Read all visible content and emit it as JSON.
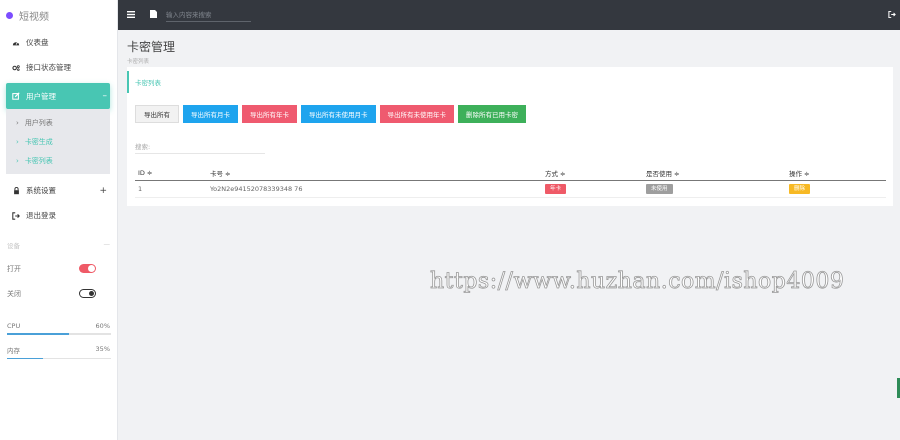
{
  "brand": {
    "name": "短视频",
    "color": "#7c4dff"
  },
  "topbar": {
    "menu_icon": "list-icon",
    "page_icon": "document-icon",
    "search_placeholder": "输入内容来搜索",
    "right_icon": "logout-icon"
  },
  "sidebar": {
    "items": [
      {
        "label": "仪表盘",
        "icon": "dashboard-icon"
      },
      {
        "label": "接口状态管理",
        "icon": "cogs-icon"
      },
      {
        "label": "用户管理",
        "icon": "edit-icon",
        "sign": "–"
      },
      {
        "label": "系统设置",
        "icon": "lock-icon",
        "sign": "+"
      },
      {
        "label": "退出登录",
        "icon": "logout-icon"
      }
    ],
    "submenu": [
      "用户列表",
      "卡密生成",
      "卡密列表"
    ],
    "section_label": "设备",
    "section_sign": "—",
    "toggles": [
      {
        "label": "打开",
        "on": true
      },
      {
        "label": "关闭",
        "on": false
      }
    ],
    "stats": [
      {
        "label": "CPU",
        "value": "60%",
        "fraction": 0.6
      },
      {
        "label": "内存",
        "value": "35%",
        "fraction": 0.35
      }
    ]
  },
  "page": {
    "title": "卡密管理",
    "subtitle": "卡密列表"
  },
  "card": {
    "title": "卡密列表",
    "buttons": [
      "导出所有",
      "导出所有月卡",
      "导出所有年卡",
      "导出所有未使用月卡",
      "导出所有未使用年卡",
      "删除所有已用卡密"
    ],
    "filter_label": "搜索:",
    "columns": [
      "ID ≑",
      "卡号 ≑",
      "方式 ≑",
      "是否使用 ≑",
      "操作 ≑"
    ],
    "rows": [
      {
        "id": "1",
        "card": "Yo2N2e94152078339348 76",
        "type": "年卡",
        "used": "未使用",
        "action": "删除"
      }
    ]
  },
  "watermark": "https://www.huzhan.com/ishop4009",
  "colors": {
    "accent": "#48c6b3",
    "blue": "#1ea4ee",
    "red": "#ef5a6f",
    "green": "#3db05a",
    "topbar": "#34383f"
  }
}
